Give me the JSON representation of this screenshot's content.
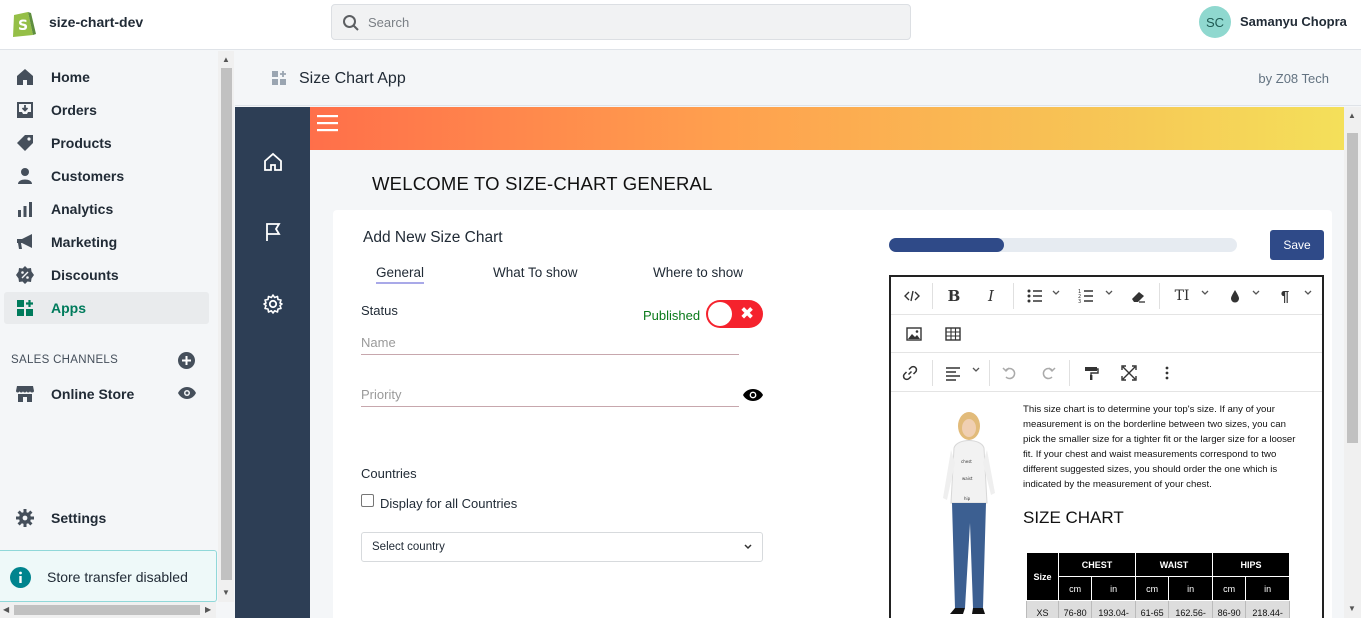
{
  "topbar": {
    "store_name": "size-chart-dev",
    "search_placeholder": "Search",
    "avatar_initials": "SC",
    "user_name": "Samanyu Chopra"
  },
  "nav": {
    "items": [
      {
        "label": "Home",
        "icon": "home-icon"
      },
      {
        "label": "Orders",
        "icon": "orders-icon"
      },
      {
        "label": "Products",
        "icon": "tag-icon"
      },
      {
        "label": "Customers",
        "icon": "person-icon"
      },
      {
        "label": "Analytics",
        "icon": "bar-chart-icon"
      },
      {
        "label": "Marketing",
        "icon": "megaphone-icon"
      },
      {
        "label": "Discounts",
        "icon": "discount-icon"
      },
      {
        "label": "Apps",
        "icon": "apps-icon"
      }
    ],
    "sales_channels_title": "SALES CHANNELS",
    "online_store": "Online Store",
    "settings": "Settings",
    "store_transfer": "Store transfer disabled"
  },
  "app_header": {
    "title": "Size Chart App",
    "by": "by Z08 Tech"
  },
  "page": {
    "welcome": "WELCOME TO SIZE-CHART GENERAL",
    "card_title": "Add New Size Chart",
    "tabs": [
      "General",
      "What To show",
      "Where to show"
    ],
    "status_label": "Status",
    "published_label": "Published",
    "name_placeholder": "Name",
    "priority_placeholder": "Priority",
    "countries_label": "Countries",
    "display_all_label": "Display for all Countries",
    "select_country": "Select country",
    "save_label": "Save",
    "progress_fraction": 0.33,
    "toggle_on": true
  },
  "editor": {
    "paragraph": "This size chart is to determine your top's size. If any of your measurement is on the borderline between two sizes, you can pick the smaller size for a tighter fit or the larger size for a looser fit. If your chest and waist measurements correspond to two different suggested sizes, you should order the one which is indicated by the measurement of your chest.",
    "size_chart_title": "SIZE CHART",
    "table": {
      "size_header": "Size",
      "groups": [
        "CHEST",
        "WAIST",
        "HIPS"
      ],
      "units": [
        "cm",
        "in",
        "cm",
        "in",
        "cm",
        "in"
      ],
      "first_row": [
        "XS",
        "76-80",
        "193.04-",
        "61-65",
        "162.56-",
        "86-90",
        "218.44-"
      ]
    }
  },
  "colors": {
    "accent_green": "#007b5c",
    "dark_sidebar": "#2d3e55",
    "primary_blue": "#2f4a88",
    "toggle_red": "#f5222d"
  }
}
